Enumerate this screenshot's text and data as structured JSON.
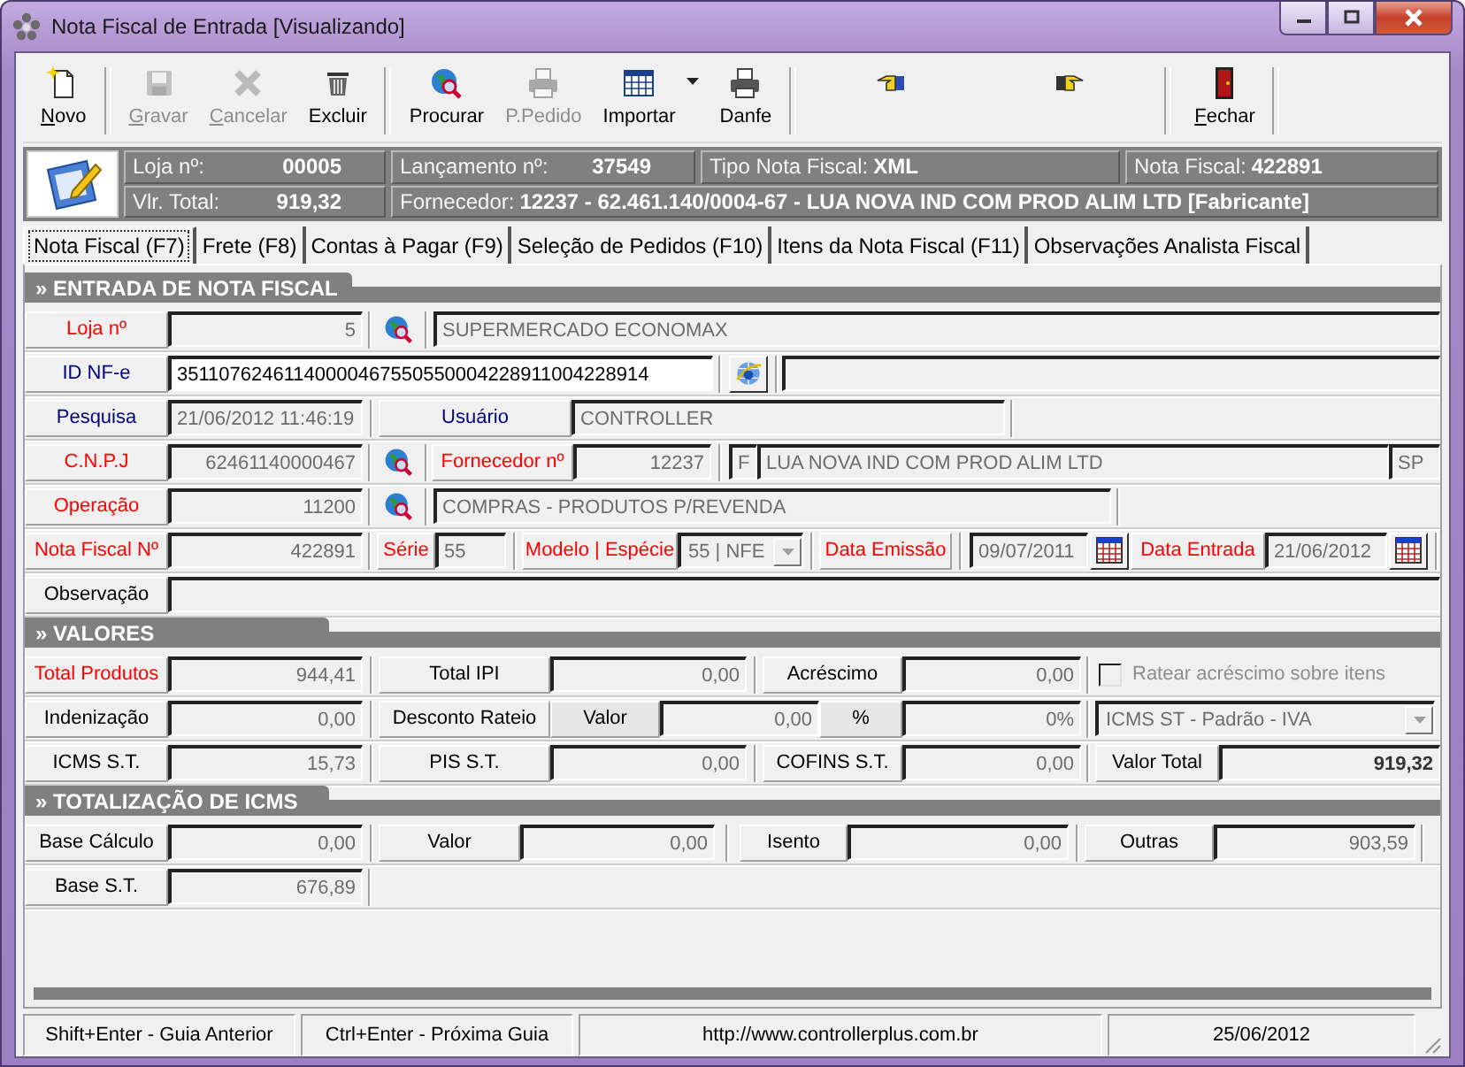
{
  "window": {
    "title": "Nota Fiscal de Entrada [Visualizando]"
  },
  "toolbar": [
    {
      "kind": "button",
      "label": "Novo",
      "disabled": false
    },
    {
      "kind": "separator"
    },
    {
      "kind": "button",
      "label": "Gravar",
      "disabled": true
    },
    {
      "kind": "button",
      "label": "Cancelar",
      "disabled": true
    },
    {
      "kind": "button",
      "label": "Excluir",
      "disabled": false
    },
    {
      "kind": "separator"
    },
    {
      "kind": "button",
      "label": "Procurar",
      "disabled": false
    },
    {
      "kind": "button",
      "label": "P.Pedido",
      "disabled": true
    },
    {
      "kind": "button",
      "label": "Importar",
      "disabled": false
    },
    {
      "kind": "button",
      "label": "Danfe",
      "disabled": false
    },
    {
      "kind": "separator"
    },
    {
      "kind": "button",
      "disabled": false
    },
    {
      "kind": "button",
      "disabled": false
    },
    {
      "kind": "separator"
    },
    {
      "kind": "button",
      "label": "Fechar",
      "disabled": false
    },
    {
      "kind": "separator"
    }
  ],
  "header": {
    "rows": [
      [
        {
          "label": "Loja nº:",
          "value": "00005"
        },
        {
          "label": "Lançamento nº:",
          "value": "37549"
        },
        {
          "label": "Tipo Nota Fiscal:",
          "value": "XML"
        },
        {
          "label": "Nota Fiscal:",
          "value": "422891"
        }
      ],
      [
        {
          "label": "Vlr. Total:",
          "value": "919,32"
        },
        {
          "label": "Fornecedor:",
          "value": "12237 - 62.461.140/0004-67 - LUA NOVA IND COM PROD ALIM LTD  [Fabricante]"
        }
      ]
    ]
  },
  "tabs": [
    {
      "label": "Nota Fiscal (F7)",
      "selected": true
    },
    {
      "label": "Frete (F8)",
      "selected": false
    },
    {
      "label": "Contas à Pagar (F9)",
      "selected": false
    },
    {
      "label": "Seleção de Pedidos (F10)",
      "selected": false
    },
    {
      "label": "Itens da Nota Fiscal (F11)",
      "selected": false
    },
    {
      "label": "Observações Analista Fiscal",
      "selected": false
    }
  ],
  "sections": [
    {
      "title": "» ENTRADA DE NOTA FISCAL",
      "rows": [
        {
          "items": [
            {
              "kind": "label",
              "text": "Loja nº",
              "required": true
            },
            {
              "kind": "field",
              "value": "5"
            },
            {
              "kind": "lookup"
            },
            {
              "kind": "field",
              "value": "SUPERMERCADO ECONOMAX"
            }
          ]
        },
        {
          "items": [
            {
              "kind": "label",
              "text": "ID NF-e",
              "required": false
            },
            {
              "kind": "field",
              "value": "35110762461140000467550550004228911004228914",
              "editable": true
            },
            {
              "kind": "web"
            },
            {
              "kind": "field"
            }
          ]
        },
        {
          "items": [
            {
              "kind": "label",
              "text": "Pesquisa",
              "required": false
            },
            {
              "kind": "field",
              "value": "21/06/2012 11:46:19"
            },
            {
              "kind": "label",
              "text": "Usuário",
              "required": false
            },
            {
              "kind": "field",
              "value": "CONTROLLER"
            }
          ]
        },
        {
          "items": [
            {
              "kind": "label",
              "text": "C.N.P.J",
              "required": true
            },
            {
              "kind": "field",
              "value": "62461140000467"
            },
            {
              "kind": "lookup"
            },
            {
              "kind": "label",
              "text": "Fornecedor nº",
              "required": true
            },
            {
              "kind": "field",
              "value": "12237"
            },
            {
              "kind": "field",
              "value": "F"
            },
            {
              "kind": "field",
              "value": "LUA NOVA IND COM PROD ALIM LTD"
            },
            {
              "kind": "field",
              "value": "SP"
            }
          ]
        },
        {
          "items": [
            {
              "kind": "label",
              "text": "Operação",
              "required": true
            },
            {
              "kind": "field",
              "value": "11200"
            },
            {
              "kind": "lookup"
            },
            {
              "kind": "field",
              "value": "COMPRAS - PRODUTOS P/REVENDA"
            }
          ]
        },
        {
          "items": [
            {
              "kind": "label",
              "text": "Nota Fiscal Nº",
              "required": true
            },
            {
              "kind": "field",
              "value": "422891"
            },
            {
              "kind": "label",
              "text": "Série",
              "required": true
            },
            {
              "kind": "field",
              "value": "55"
            },
            {
              "kind": "label",
              "text": "Modelo | Espécie",
              "required": true
            },
            {
              "kind": "select",
              "value": "55 | NFE",
              "disabled": true
            },
            {
              "kind": "label",
              "text": "Data Emissão",
              "required": true
            },
            {
              "kind": "field",
              "value": "09/07/2011"
            },
            {
              "kind": "calendar"
            },
            {
              "kind": "label",
              "text": "Data Entrada",
              "required": true
            },
            {
              "kind": "field",
              "value": "21/06/2012"
            },
            {
              "kind": "calendar"
            }
          ]
        },
        {
          "items": [
            {
              "kind": "label",
              "text": "Observação",
              "required": false
            },
            {
              "kind": "field"
            }
          ]
        }
      ]
    },
    {
      "title": "» VALORES",
      "rows": [
        {
          "items": [
            {
              "kind": "label",
              "text": "Total Produtos",
              "required": true
            },
            {
              "kind": "field",
              "value": "944,41"
            },
            {
              "kind": "label",
              "text": "Total IPI",
              "required": false
            },
            {
              "kind": "field",
              "value": "0,00"
            },
            {
              "kind": "label",
              "text": "Acréscimo",
              "required": false
            },
            {
              "kind": "field",
              "value": "0,00"
            },
            {
              "kind": "check",
              "label": "Ratear acréscimo sobre itens",
              "checked": false,
              "disabled": true
            }
          ]
        },
        {
          "items": [
            {
              "kind": "label",
              "text": "Indenização",
              "required": false
            },
            {
              "kind": "field",
              "value": "0,00"
            },
            {
              "kind": "label",
              "text": "Desconto Rateio",
              "required": false
            },
            {
              "kind": "sublabel",
              "text": "Valor"
            },
            {
              "kind": "field",
              "value": "0,00"
            },
            {
              "kind": "sublabel",
              "text": "%"
            },
            {
              "kind": "field",
              "value": "0%"
            },
            {
              "kind": "select",
              "value": "ICMS ST - Padrão - IVA",
              "disabled": true
            }
          ]
        },
        {
          "items": [
            {
              "kind": "label",
              "text": "ICMS S.T.",
              "required": false
            },
            {
              "kind": "field",
              "value": "15,73"
            },
            {
              "kind": "label",
              "text": "PIS S.T.",
              "required": false
            },
            {
              "kind": "field",
              "value": "0,00"
            },
            {
              "kind": "label",
              "text": "COFINS S.T.",
              "required": false
            },
            {
              "kind": "field",
              "value": "0,00"
            },
            {
              "kind": "label",
              "text": "Valor Total",
              "required": false
            },
            {
              "kind": "field",
              "value": "919,32"
            }
          ]
        }
      ]
    },
    {
      "title": "» TOTALIZAÇÃO DE ICMS",
      "rows": [
        {
          "items": [
            {
              "kind": "label",
              "text": "Base Cálculo",
              "required": false
            },
            {
              "kind": "field",
              "value": "0,00"
            },
            {
              "kind": "label",
              "text": "Valor",
              "required": false
            },
            {
              "kind": "field",
              "value": "0,00"
            },
            {
              "kind": "label",
              "text": "Isento",
              "required": false
            },
            {
              "kind": "field",
              "value": "0,00"
            },
            {
              "kind": "label",
              "text": "Outras",
              "required": false
            },
            {
              "kind": "field",
              "value": "903,59"
            }
          ]
        },
        {
          "items": [
            {
              "kind": "label",
              "text": "Base S.T.",
              "required": false
            },
            {
              "kind": "field",
              "value": "676,89"
            }
          ]
        }
      ]
    }
  ],
  "status_bar": [
    "Shift+Enter - Guia Anterior",
    "Ctrl+Enter - Próxima Guia",
    "http://www.controllerplus.com.br",
    "25/06/2012"
  ]
}
